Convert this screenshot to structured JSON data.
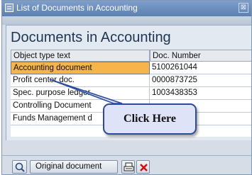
{
  "window": {
    "title": "List of Documents in Accounting",
    "close_label": "⊠"
  },
  "main": {
    "heading": "Documents in Accounting"
  },
  "table": {
    "headers": [
      "Object type text",
      "Doc. Number"
    ],
    "rows": [
      {
        "type": "Accounting document",
        "number": "5100261044",
        "selected": true
      },
      {
        "type": "Profit center doc.",
        "number": "0000873725"
      },
      {
        "type": "Spec. purpose ledger",
        "number": "1003438353"
      },
      {
        "type": "Controlling Document",
        "number": ""
      },
      {
        "type": "Funds Management d",
        "number": ""
      }
    ]
  },
  "toolbar": {
    "find_icon": "find-icon",
    "original_document_label": "Original document",
    "print_icon": "print-icon",
    "cancel_icon": "cancel-icon"
  },
  "callout": {
    "label": "Click Here"
  },
  "colors": {
    "title_bar": "#6e90c0",
    "selected_row": "#f6b54a",
    "callout_border": "#2c4b9e",
    "callout_fill": "#dfe3f7",
    "cancel_red": "#cc1111"
  }
}
